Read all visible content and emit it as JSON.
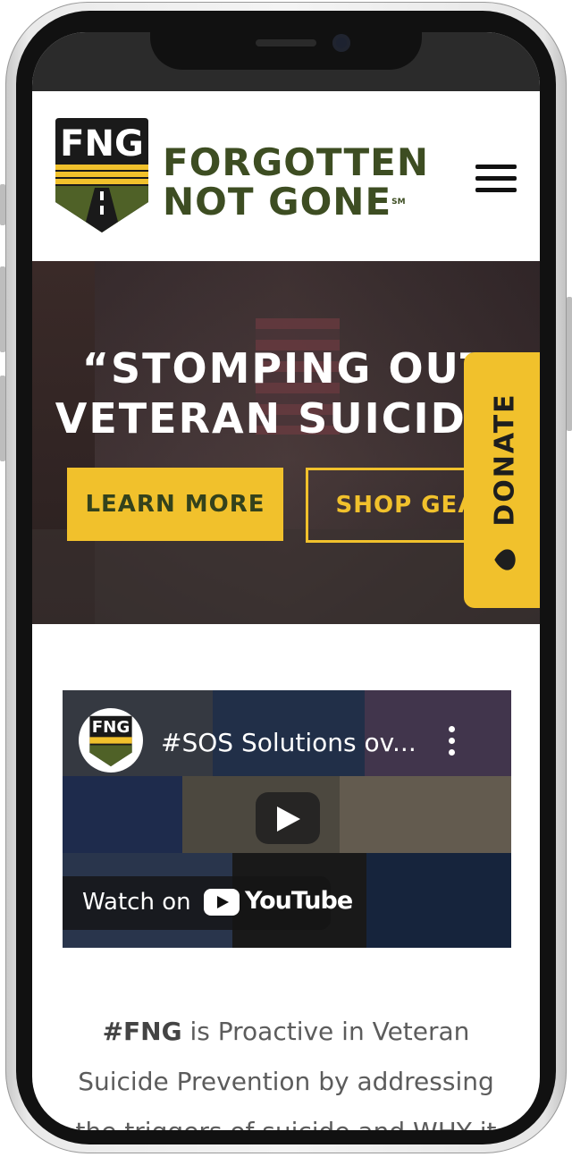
{
  "header": {
    "logo_badge": "FNG",
    "logo_line1": "FORGOTTEN",
    "logo_line2": "NOT GONE",
    "logo_mark": "SM",
    "menu_icon": "hamburger-menu-icon"
  },
  "hero": {
    "title_line1": "“STOMPING OUT",
    "title_line2": "VETERAN SUICIDE!",
    "learn_more": "LEARN MORE",
    "shop_gear": "SHOP GEAR"
  },
  "donate": {
    "label": "DONATE",
    "icon": "heart-icon"
  },
  "video": {
    "channel_badge": "FNG",
    "title": "#SOS Solutions ov...",
    "watch_on": "Watch on",
    "youtube": "YouTube"
  },
  "intro": {
    "bold": "#FNG",
    "line1_rest": " is Proactive in Veteran",
    "line2": "Suicide Prevention by addressing",
    "line3": "the triggers of suicide and WHY it"
  },
  "colors": {
    "brand_green": "#3d4d22",
    "accent_yellow": "#f1c12c",
    "hero_overlay": "#2e2226"
  }
}
